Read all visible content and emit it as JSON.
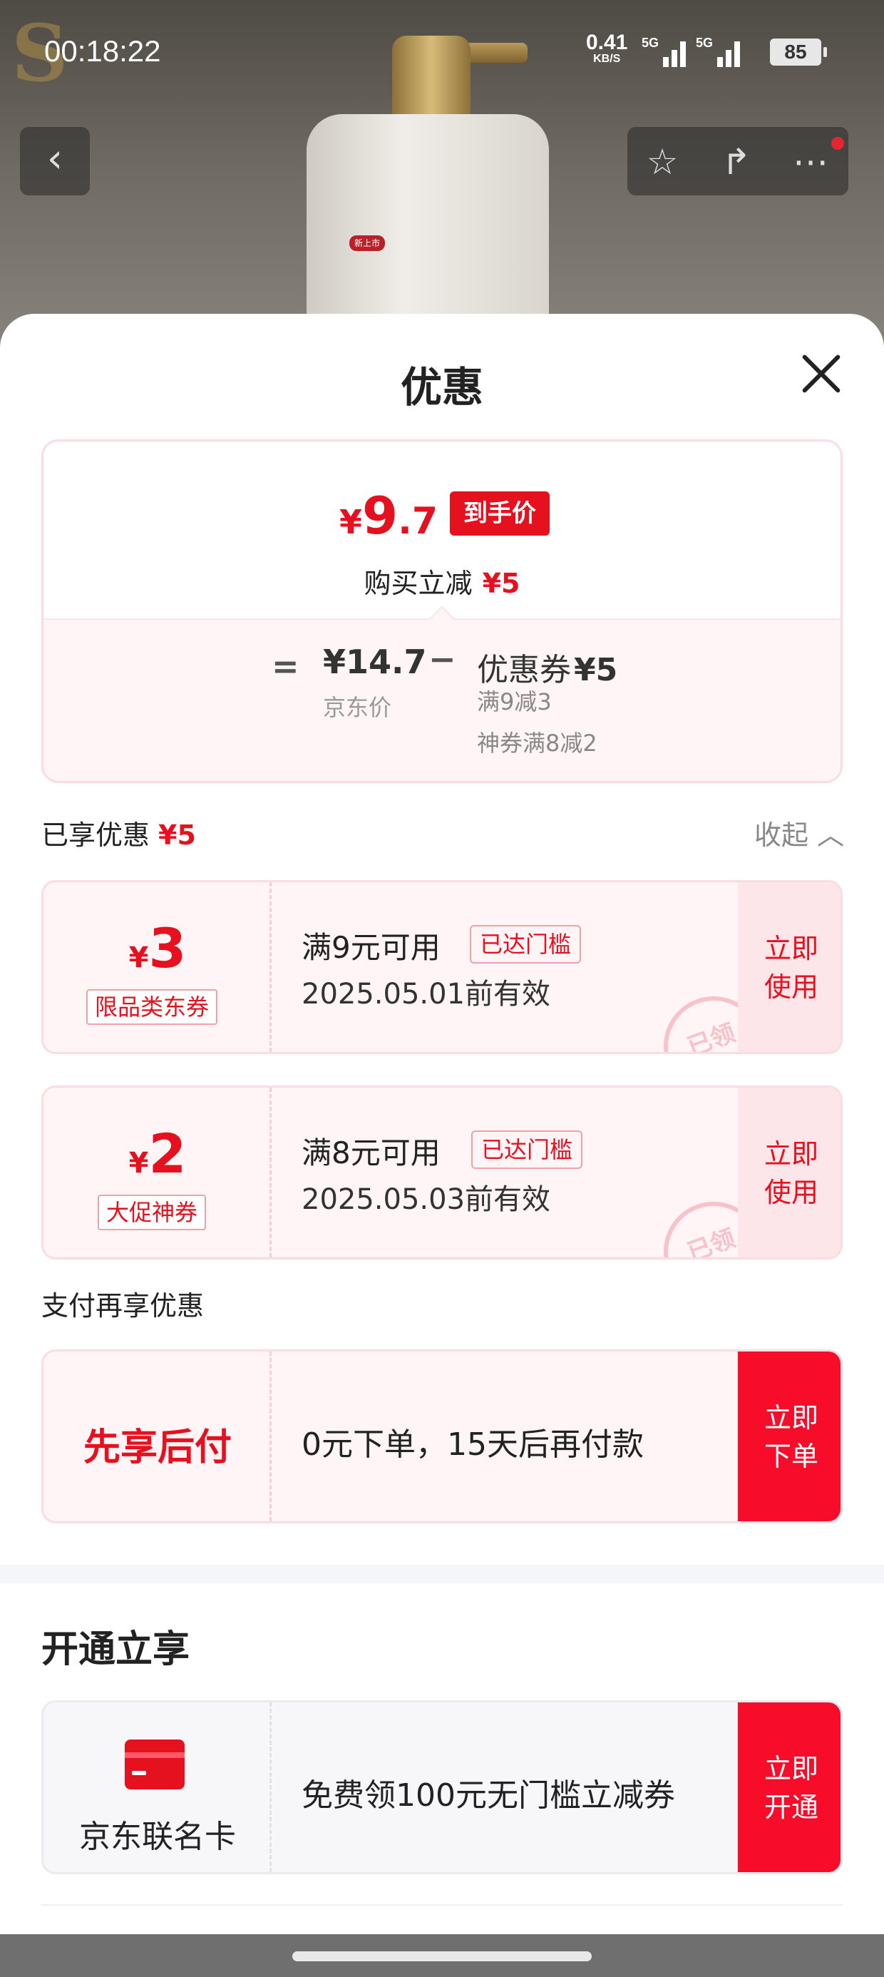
{
  "status_bar": {
    "time": "00:18:22",
    "speed": "0.41",
    "speed_unit": "KB/S",
    "net1": "5G",
    "net2": "5G",
    "battery": "85"
  },
  "background": {
    "brand": "SLEK",
    "bottle_tag": "新上市"
  },
  "sheet": {
    "title": "优惠",
    "summary": {
      "currency": "¥",
      "price_int": "9",
      "price_dec": ".7",
      "price_tag": "到手价",
      "save_label": "购买立减",
      "save_value": "¥5",
      "equals": "=",
      "jd_price": "¥14.7",
      "jd_label": "京东价",
      "minus": "−",
      "coupon_label": "优惠券",
      "coupon_total": "¥5",
      "coupon_1": "满9减3",
      "coupon_2": "神券满8减2"
    },
    "enjoyed": {
      "label": "已享优惠",
      "value": "¥5",
      "collapse": "收起"
    },
    "coupons": [
      {
        "currency": "¥",
        "amount": "3",
        "kind": "限品类东券",
        "condition": "满9元可用",
        "reached": "已达门槛",
        "expiry": "2025.05.01前有效",
        "stamp": "已领",
        "action_1": "立即",
        "action_2": "使用"
      },
      {
        "currency": "¥",
        "amount": "2",
        "kind": "大促神券",
        "condition": "满8元可用",
        "reached": "已达门槛",
        "expiry": "2025.05.03前有效",
        "stamp": "已领",
        "action_1": "立即",
        "action_2": "使用"
      }
    ],
    "pay": {
      "title": "支付再享优惠",
      "name": "先享后付",
      "desc": "0元下单，15天后再付款",
      "action_1": "立即",
      "action_2": "下单"
    },
    "open": {
      "title": "开通立享",
      "card_name": "京东联名卡",
      "desc": "免费领100元无门槛立减券",
      "action_1": "立即",
      "action_2": "开通"
    }
  },
  "colors": {
    "accent": "#e6111f",
    "button": "#f70d2a",
    "coupon_bg": "#fff5f6"
  },
  "icons": {
    "back": "chevron-left-icon",
    "favorite": "star-icon",
    "share": "share-icon",
    "more": "more-icon",
    "close": "close-icon",
    "card": "credit-card-icon"
  }
}
